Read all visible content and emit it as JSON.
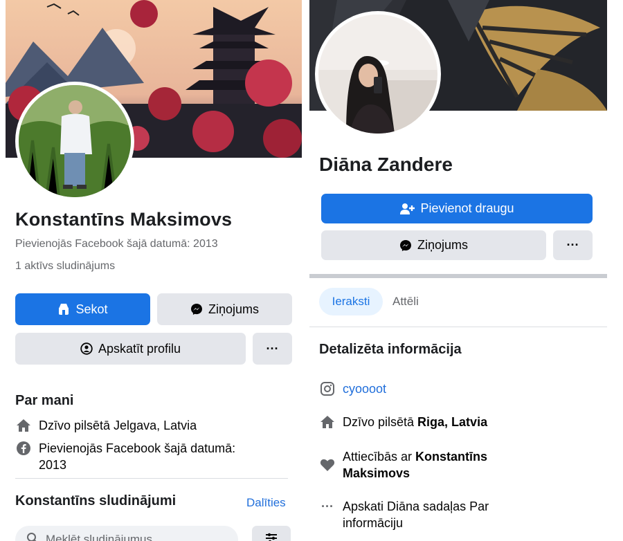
{
  "left_profile": {
    "name": "Konstantīns Maksimovs",
    "joined_text": "Pievienojās Facebook šajā datumā: 2013",
    "listings_text": "1 aktīvs sludinājums",
    "follow_button": "Sekot",
    "message_button": "Ziņojums",
    "view_profile_button": "Apskatīt profilu",
    "more_button": "···",
    "about": {
      "title": "Par mani",
      "lives_in": "Dzīvo pilsētā Jelgava, Latvia",
      "joined_line1": "Pievienojās Facebook šajā datumā:",
      "joined_line2": "2013"
    },
    "listings": {
      "title": "Konstantīns sludinājumi",
      "share_link": "Dalīties",
      "search_placeholder": "Meklēt sludinājumus"
    }
  },
  "right_profile": {
    "name": "Diāna Zandere",
    "add_friend_button": "Pievienot draugu",
    "message_button": "Ziņojums",
    "more_button": "···",
    "tabs": [
      "Ieraksti",
      "Attēli"
    ],
    "details": {
      "title": "Detalizēta informācija",
      "instagram": "cyoooot",
      "lives_in_prefix": "Dzīvo pilsētā ",
      "lives_in_city": "Riga, Latvia",
      "relationship_prefix": "Attiecībās ar ",
      "relationship_partner": "Konstantīns Maksimovs",
      "about_link_line1": "Apskati Diāna sadaļas Par",
      "about_link_line2": "informāciju"
    }
  },
  "colors": {
    "accent": "#1b74e4",
    "button_gray": "#e4e6eb",
    "muted_text": "#65676b"
  },
  "icons": [
    "house-icon",
    "facebook-icon",
    "instagram-icon",
    "heart-icon",
    "messenger-icon",
    "add-friend-icon",
    "store-icon",
    "user-circle-icon",
    "search-icon",
    "filter-icon",
    "more-dots-icon"
  ]
}
